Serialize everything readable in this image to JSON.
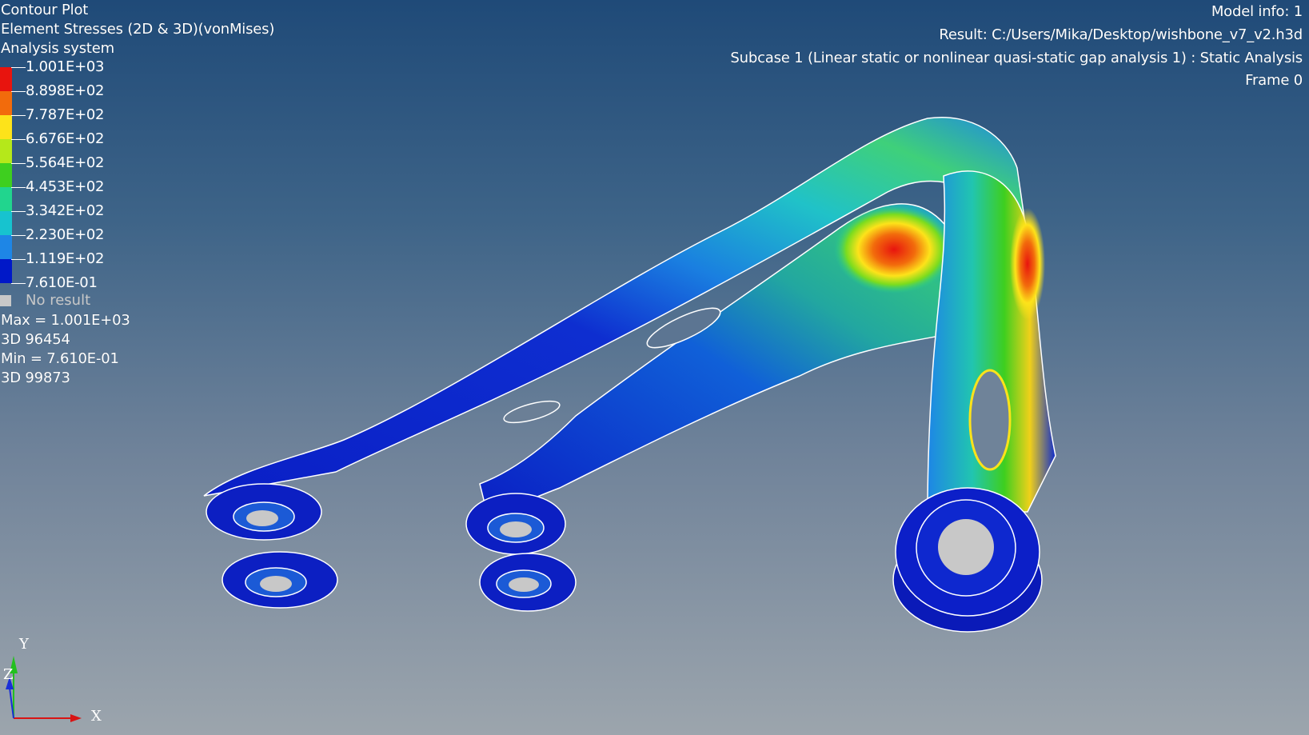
{
  "header_left": {
    "plot_type": "Contour Plot",
    "result_type": "Element Stresses (2D & 3D)(vonMises)",
    "system": "Analysis system"
  },
  "header_right": {
    "model_info": "Model info: 1",
    "result_path": "Result: C:/Users/Mika/Desktop/wishbone_v7_v2.h3d",
    "subcase": "Subcase 1 (Linear static or nonlinear quasi-static gap analysis 1) : Static Analysis",
    "frame": "Frame 0"
  },
  "legend": {
    "labels": [
      "1.001E+03",
      "8.898E+02",
      "7.787E+02",
      "6.676E+02",
      "5.564E+02",
      "4.453E+02",
      "3.342E+02",
      "2.230E+02",
      "1.119E+02",
      "7.610E-01"
    ],
    "colors": [
      "#e8140e",
      "#f26b0c",
      "#fde31a",
      "#b5e81a",
      "#3ecf1f",
      "#21d58e",
      "#17c3cf",
      "#1e86e6",
      "#0018c8"
    ],
    "no_result": "No result"
  },
  "stats": {
    "max": "Max = 1.001E+03",
    "max_element": "3D 96454",
    "min": "Min = 7.610E-01",
    "min_element": "3D 99873"
  },
  "triad": {
    "y_label": "Y",
    "z_label": "Z",
    "x_label": "X"
  }
}
